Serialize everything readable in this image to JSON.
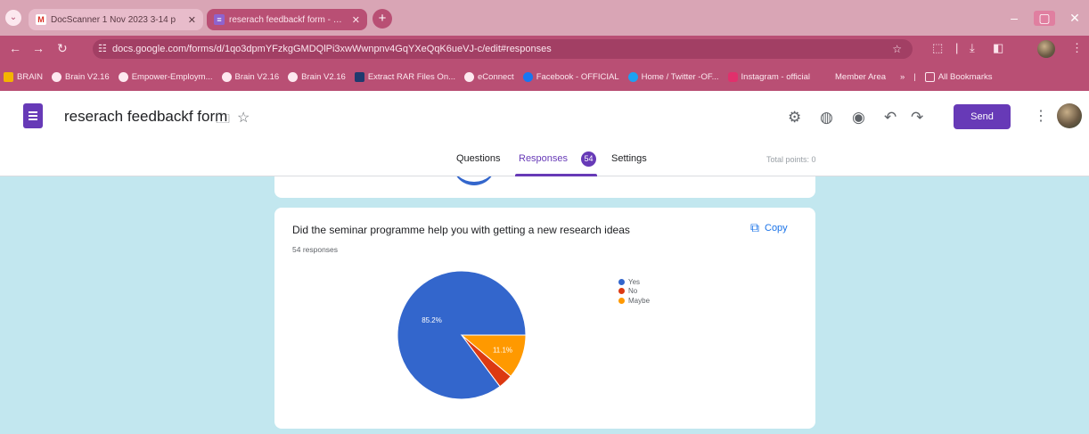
{
  "browser": {
    "tabs": [
      {
        "favicon": "M",
        "label": "DocScanner 1 Nov 2023 3-14 p",
        "active": false
      },
      {
        "favicon": "≡",
        "label": "reserach feedbackf form - Goo",
        "active": true
      }
    ],
    "new_tab_symbol": "+",
    "window_controls": {
      "minimize": "–",
      "maximize": "▢",
      "close": "✕"
    },
    "url": "docs.google.com/forms/d/1qo3dpmYFzkgGMDQlPi3xwWwnpnv4GqYXeQqK6ueVJ-c/edit#responses",
    "bookmarks": [
      "BRAIN",
      "Brain V2.16",
      "Empower-Employm...",
      "Brain V2.16",
      "Brain V2.16",
      "Extract RAR Files On...",
      "eConnect",
      "Facebook - OFFICIAL",
      "Home / Twitter -OF...",
      "Instagram - official",
      "Member Area"
    ],
    "overflow": "»",
    "all_bookmarks": "All Bookmarks"
  },
  "form": {
    "title": "reserach feedbackf form",
    "send_label": "Send",
    "tabs": {
      "questions": "Questions",
      "responses": "Responses",
      "settings": "Settings"
    },
    "responses_badge": "54",
    "total_points": "Total points: 0"
  },
  "question_card": {
    "question": "Did the seminar programme help you with getting a new research ideas",
    "response_count": "54 responses",
    "copy_label": "Copy"
  },
  "chart_data": {
    "type": "pie",
    "slices": [
      {
        "label": "Yes",
        "value": 85.2,
        "color": "#3366cc",
        "data_label": "85.2%"
      },
      {
        "label": "No",
        "value": 3.7,
        "color": "#dc3912",
        "data_label": ""
      },
      {
        "label": "Maybe",
        "value": 11.1,
        "color": "#ff9900",
        "data_label": "11.1%"
      }
    ],
    "legend_position": "right"
  },
  "colors": {
    "accent": "#673ab7",
    "background": "#c2e7ef",
    "browser_chrome": "#b94f74",
    "link_blue": "#1a73e8"
  }
}
